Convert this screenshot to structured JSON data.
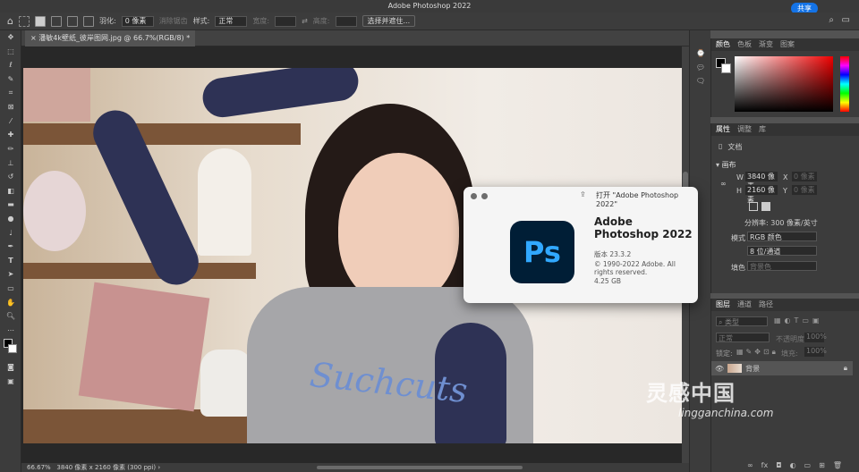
{
  "window": {
    "title": "Adobe Photoshop 2022"
  },
  "options_bar": {
    "feather_label": "羽化:",
    "feather_value": "0 像素",
    "antialias_label": "消除锯齿",
    "style_label": "样式:",
    "style_value": "正常",
    "width_label": "宽度:",
    "height_label": "高度:",
    "select_subject_button": "选择并遮住...",
    "share_button": "共享"
  },
  "document": {
    "tab_title": "潘敏4k壁纸_彼岸图网.jpg @ 66.7%(RGB/8) *"
  },
  "photo": {
    "shirt_text": "Suchcuts"
  },
  "status_bar": {
    "zoom": "66.67%",
    "info": "3840 像素 x 2160 像素 (300 ppi)"
  },
  "color_panel": {
    "tabs": [
      "颜色",
      "色板",
      "渐变",
      "图案"
    ]
  },
  "properties_panel": {
    "tabs": [
      "属性",
      "调整",
      "库"
    ],
    "document_label": "文档",
    "section": "画布",
    "w_label": "W",
    "w_value": "3840 像素",
    "h_label": "H",
    "h_value": "2160 像素",
    "x_label": "X",
    "x_value": "0 像素",
    "y_label": "Y",
    "y_value": "0 像素",
    "resolution": "分辨率: 300 像素/英寸",
    "mode_label": "模式",
    "mode_value": "RGB 颜色",
    "depth_value": "8 位/通道",
    "fill_label": "填色",
    "fill_value": "背景色"
  },
  "layers_panel": {
    "tabs": [
      "图层",
      "通道",
      "路径"
    ],
    "filter_label": "类型",
    "blend_mode": "正常",
    "opacity_label": "不透明度:",
    "opacity_value": "100%",
    "lock_label": "锁定:",
    "fill_label": "填充:",
    "fill_value": "100%",
    "layer_name": "背景"
  },
  "about_dialog": {
    "header": "打开 \"Adobe Photoshop 2022\"",
    "icon_text": "Ps",
    "product_line1": "Adobe",
    "product_line2": "Photoshop 2022",
    "version": "版本 23.3.2",
    "copyright": "© 1990-2022 Adobe. All rights reserved.",
    "size": "4.25 GB"
  },
  "watermark": {
    "text_cn": "灵感中国",
    "text_en": "lingganchina.com"
  },
  "colors": {
    "accent": "#1473e6",
    "ps_icon_bg": "#001e36",
    "ps_icon_text": "#31a8ff"
  }
}
